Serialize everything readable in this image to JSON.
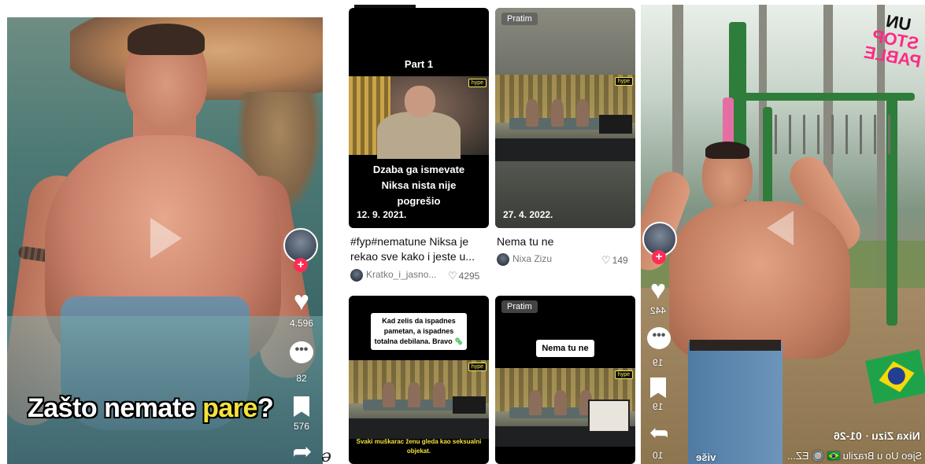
{
  "left_video": {
    "caption_part1": "Zašto nemate ",
    "caption_highlight": "pare",
    "caption_end": "?",
    "likes": "4.596",
    "comments": "82",
    "saves": "576"
  },
  "stray_glyph": "ə",
  "grid": {
    "cards": [
      {
        "part_label": "Part 1",
        "overlay_text": "Dzaba ga ismevate Niksa nista nije pogrešio",
        "date": "12. 9. 2021.",
        "title": "#fyp#nematune Niksa je rekao sve kako i jeste u...",
        "author": "Kratko_i_jasno...",
        "likes": "4295",
        "hype": "hype"
      },
      {
        "badge": "Pratim",
        "date": "27. 4. 2022.",
        "title": "Nema tu ne",
        "author": "Nixa Zizu",
        "likes": "149",
        "hype": "hype"
      },
      {
        "overlay_text": "Kad zelis da ispadnes pametan, a ispadnes totalna debilana. Bravo 🦠",
        "bottom_text": "Svaki muškarac ženu gleda kao seksualni objekat.",
        "hype": "hype"
      },
      {
        "badge": "Pratim",
        "overlay_text": "Nema tu ne",
        "hype": "hype"
      }
    ]
  },
  "right_video": {
    "likes": "442",
    "comments": "19",
    "saves": "19",
    "shares": "10",
    "author_line": "Nixa Zizu · 01-26",
    "description": "Sjeo Uo u Brazilu 🇧🇷 🔘 EZ...",
    "more_label": "više",
    "sticker_line1": "UN",
    "sticker_line2": "STOP",
    "sticker_line3": "PABLE"
  },
  "colors": {
    "accent": "#fe2c55",
    "caption_highlight": "#f5e23a",
    "hype": "#f0e34a"
  }
}
